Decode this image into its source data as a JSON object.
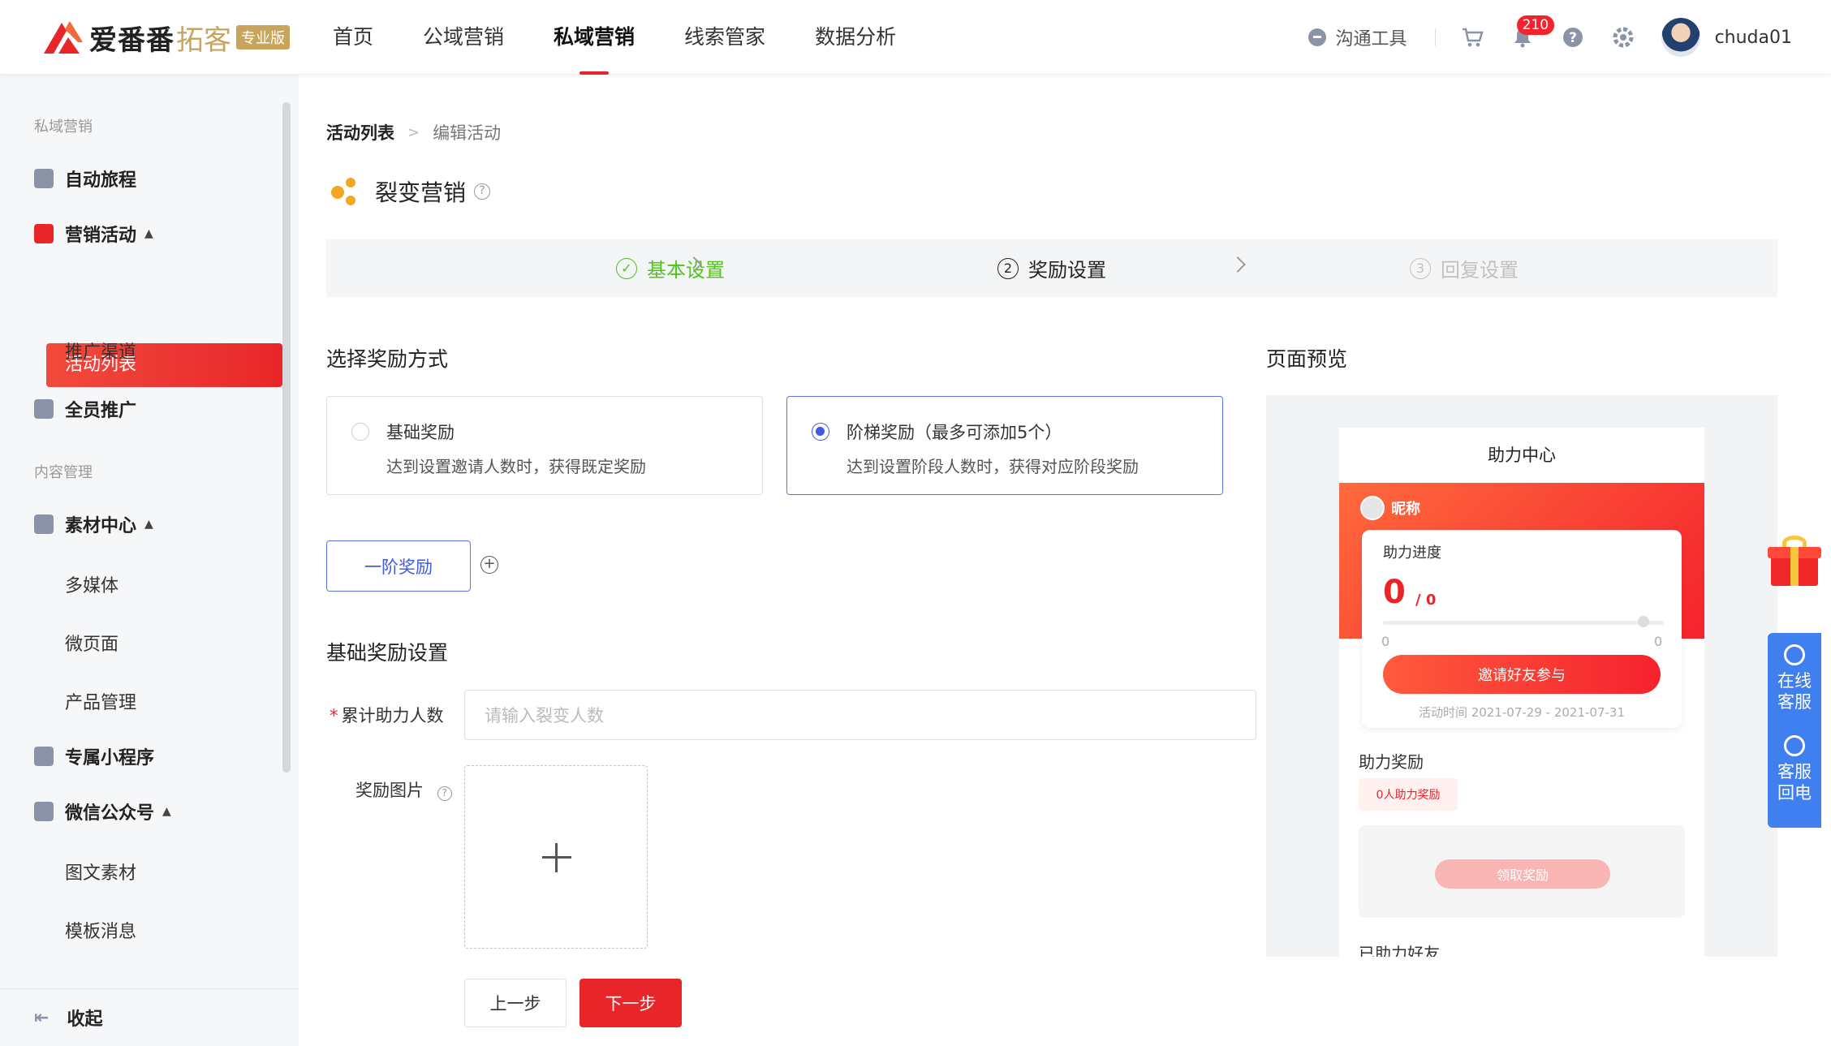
{
  "header": {
    "logo": {
      "name": "爱番番",
      "sub": "拓客",
      "badge": "专业版"
    },
    "nav": [
      "首页",
      "公域营销",
      "私域营销",
      "线索管家",
      "数据分析"
    ],
    "nav_active_index": 2,
    "tool_label": "沟通工具",
    "notification_count": "210",
    "username": "chuda01"
  },
  "sidebar": {
    "group1": "私域营销",
    "items": {
      "journey": "自动旅程",
      "campaign": "营销活动",
      "campaign_list": "活动列表",
      "channel": "推广渠道",
      "staff": "全员推广"
    },
    "group2": "内容管理",
    "content": {
      "material": "素材中心",
      "media": "多媒体",
      "micro_page": "微页面",
      "product": "产品管理",
      "mini_program": "专属小程序",
      "wechat": "微信公众号",
      "article": "图文素材",
      "template": "模板消息"
    },
    "collapse": "收起"
  },
  "main": {
    "breadcrumb": [
      "活动列表",
      "编辑活动"
    ],
    "title": "裂变营销",
    "steps": [
      {
        "num": "✓",
        "label": "基本设置",
        "state": "done"
      },
      {
        "num": "2",
        "label": "奖励设置",
        "state": "current"
      },
      {
        "num": "3",
        "label": "回复设置",
        "state": "todo"
      }
    ],
    "reward_section": "选择奖励方式",
    "options": [
      {
        "title": "基础奖励",
        "desc": "达到设置邀请人数时，获得既定奖励",
        "selected": false
      },
      {
        "title": "阶梯奖励（最多可添加5个）",
        "desc": "达到设置阶段人数时，获得对应阶段奖励",
        "selected": true
      }
    ],
    "tier_button": "一阶奖励",
    "add_icon": "⊕",
    "basic_section": "基础奖励设置",
    "form": {
      "count_label": "累计助力人数",
      "count_placeholder": "请输入裂变人数",
      "image_label": "奖励图片"
    },
    "buttons": {
      "prev": "上一步",
      "next": "下一步"
    }
  },
  "preview": {
    "section": "页面预览",
    "phone_title": "助力中心",
    "nickname": "昵称",
    "progress_label": "助力进度",
    "progress_value": "0",
    "progress_total": "/ 0",
    "range_min": "0",
    "range_max": "0",
    "invite_button": "邀请好友参与",
    "activity_time": "活动时间 2021-07-29 - 2021-07-31",
    "reward_section": "助力奖励",
    "reward_tag": "0人助力奖励",
    "claim_button": "领取奖励",
    "friends_section": "已助力好友"
  },
  "float": {
    "online_service": "在线客服",
    "callback": "客服回电"
  },
  "colors": {
    "primary": "#e8262a",
    "blue": "#3d5ae0",
    "gold": "#c9a45c",
    "success": "#52c41a"
  }
}
